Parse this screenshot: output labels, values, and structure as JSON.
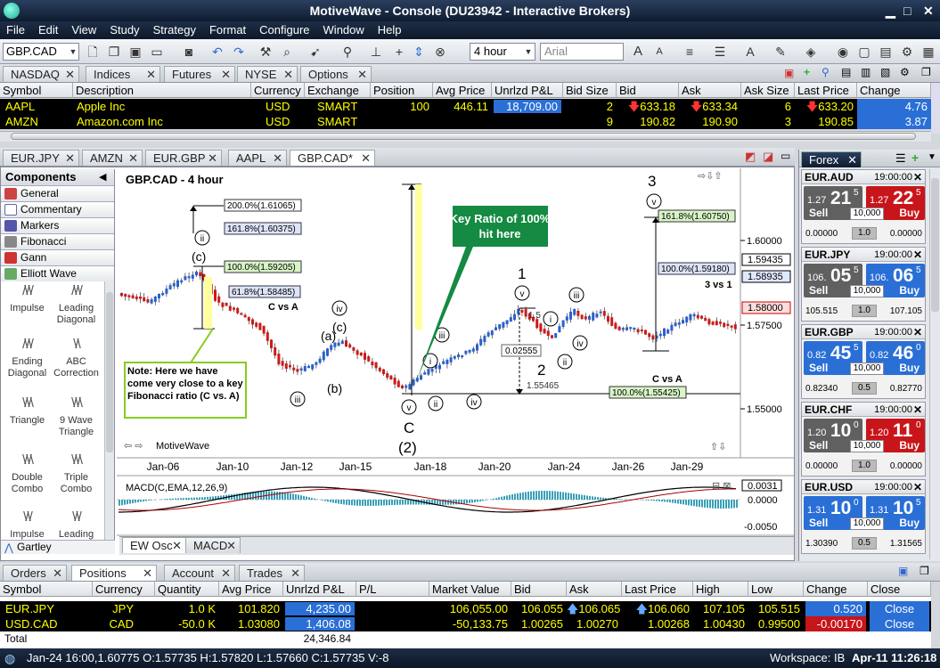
{
  "window": {
    "title": "MotiveWave - Console (DU23942 - Interactive Brokers)"
  },
  "menu": [
    "File",
    "Edit",
    "View",
    "Study",
    "Strategy",
    "Format",
    "Configure",
    "Window",
    "Help"
  ],
  "toolbar": {
    "symbol": "GBP.CAD",
    "bar_size": "4 hour",
    "font": "Arial"
  },
  "watch_tabs": [
    "NASDAQ",
    "Indices",
    "Futures",
    "NYSE",
    "Options"
  ],
  "watch_grid": {
    "headers": [
      "Symbol",
      "Description",
      "Currency",
      "Exchange",
      "Position",
      "Avg Price",
      "Unrlzd P&L",
      "Bid Size",
      "Bid",
      "Ask",
      "Ask Size",
      "Last Price",
      "Change"
    ],
    "rows": [
      [
        "AAPL",
        "Apple Inc",
        "USD",
        "SMART",
        "100",
        "446.11",
        "18,709.00",
        "2",
        "633.18",
        "633.34",
        "6",
        "633.20",
        "4.76"
      ],
      [
        "AMZN",
        "Amazon.com Inc",
        "USD",
        "SMART",
        "",
        "",
        "",
        "9",
        "190.82",
        "190.90",
        "3",
        "190.85",
        "3.87"
      ]
    ]
  },
  "chart_tabs": [
    "EUR.JPY",
    "AMZN",
    "EUR.GBP",
    "AAPL",
    "GBP.CAD*"
  ],
  "components": {
    "title": "Components",
    "items": [
      "General",
      "Commentary",
      "Markers",
      "Fibonacci",
      "Gann",
      "Elliott Wave"
    ],
    "tools": [
      [
        "Impulse",
        "Leading Diagonal"
      ],
      [
        "Ending Diagonal",
        "ABC Correction"
      ],
      [
        "Triangle",
        "9 Wave Triangle"
      ],
      [
        "Double Combo",
        "Triple Combo"
      ],
      [
        "Impulse",
        "Leading"
      ]
    ],
    "footer": "Gartley"
  },
  "chart": {
    "title": "GBP.CAD - 4 hour",
    "brand": "MotiveWave",
    "callout_key": "Key Ratio of 100% hit here",
    "note": "Note: Here we have come very close to a key Fibonacci ratio (C vs. A)",
    "labels": {
      "c_vs_a_1": "C vs A",
      "c_vs_a_2": "C vs A",
      "three_vs_one": "3 vs 1",
      "fib_200": "200.0%(1.61065)",
      "fib_1618a": "161.8%(1.60375)",
      "fib_100a": "100.0%(1.59205)",
      "fib_618": "61.8%(1.58485)",
      "fib_1618b": "161.8%(1.60750)",
      "fib_100b": "100.0%(1.59180)",
      "fib_100c": "100.0%(1.55425)",
      "measure": "0.02555",
      "low_price": "1.55465",
      "near_price": "1.5"
    },
    "waves": {
      "c_small": "(c)",
      "a_small": "(a)",
      "b_small": "(b)",
      "c2_small": "(c)",
      "C": "C",
      "two_paren": "(2)",
      "one": "1",
      "two": "2",
      "three": "3"
    },
    "roman": {
      "ii": "ii",
      "iii": "iii",
      "iv": "iv",
      "v": "v",
      "i": "i"
    },
    "price_axis": [
      "1.60000",
      "1.57500",
      "1.55000"
    ],
    "price_tags": {
      "t1": "1.59435",
      "t2": "1.58935",
      "t3": "1.58000"
    },
    "time_axis": [
      "Jan-06",
      "Jan-10",
      "Jan-12",
      "Jan-15",
      "Jan-18",
      "Jan-20",
      "Jan-24",
      "Jan-26",
      "Jan-29"
    ],
    "macd_title": "MACD(C,EMA,12,26,9)",
    "macd_axis": [
      "0.0031",
      "0.0000",
      "-0.0050"
    ],
    "bottom_tabs": [
      "EW Osc",
      "MACD"
    ]
  },
  "forex": {
    "tab": "Forex",
    "pairs": [
      {
        "name": "EUR.AUD",
        "time": "19:00:00",
        "sell_small": "1.27",
        "sell_big": "21",
        "sell_sup": "5",
        "buy_small": "1.27",
        "buy_big": "22",
        "buy_sup": "5",
        "qty": "10,000",
        "low": "0.00000",
        "spread": "1.0",
        "high": "0.00000",
        "sell_color": "#606060",
        "buy_color": "#c8151a"
      },
      {
        "name": "EUR.JPY",
        "time": "19:00:00",
        "sell_small": "106.",
        "sell_big": "05",
        "sell_sup": "5",
        "buy_small": "106.",
        "buy_big": "06",
        "buy_sup": "5",
        "qty": "10,000",
        "low": "105.515",
        "spread": "1.0",
        "high": "107.105",
        "sell_color": "#606060",
        "buy_color": "#2a6fd6"
      },
      {
        "name": "EUR.GBP",
        "time": "19:00:00",
        "sell_small": "0.82",
        "sell_big": "45",
        "sell_sup": "5",
        "buy_small": "0.82",
        "buy_big": "46",
        "buy_sup": "0",
        "qty": "10,000",
        "low": "0.82340",
        "spread": "0.5",
        "high": "0.82770",
        "sell_color": "#2a6fd6",
        "buy_color": "#2a6fd6"
      },
      {
        "name": "EUR.CHF",
        "time": "19:00:00",
        "sell_small": "1.20",
        "sell_big": "10",
        "sell_sup": "0",
        "buy_small": "1.20",
        "buy_big": "11",
        "buy_sup": "0",
        "qty": "10,000",
        "low": "0.00000",
        "spread": "1.0",
        "high": "0.00000",
        "sell_color": "#606060",
        "buy_color": "#c8151a"
      },
      {
        "name": "EUR.USD",
        "time": "19:00:00",
        "sell_small": "1.31",
        "sell_big": "10",
        "sell_sup": "0",
        "buy_small": "1.31",
        "buy_big": "10",
        "buy_sup": "5",
        "qty": "10,000",
        "low": "1.30390",
        "spread": "0.5",
        "high": "1.31565",
        "sell_color": "#2a6fd6",
        "buy_color": "#2a6fd6"
      }
    ],
    "sell_label": "Sell",
    "buy_label": "Buy"
  },
  "positions_tabs": [
    "Orders",
    "Positions",
    "Account",
    "Trades"
  ],
  "positions_grid": {
    "headers": [
      "Symbol",
      "Currency",
      "Quantity",
      "Avg Price",
      "Unrlzd P&L",
      "P/L",
      "Market Value",
      "Bid",
      "Ask",
      "Last Price",
      "High",
      "Low",
      "Change",
      "Close"
    ],
    "rows": [
      [
        "EUR.JPY",
        "JPY",
        "1.0 K",
        "101.820",
        "4,235.00",
        "",
        "106,055.00",
        "106.055",
        "106.065",
        "106.060",
        "107.105",
        "105.515",
        "0.520",
        "Close"
      ],
      [
        "USD.CAD",
        "CAD",
        "-50.0 K",
        "1.03080",
        "1,406.08",
        "",
        "-50,133.75",
        "1.00265",
        "1.00270",
        "1.00268",
        "1.00430",
        "0.99500",
        "-0.00170",
        "Close"
      ]
    ],
    "total_label": "Total",
    "total_value": "24,346.84"
  },
  "status": {
    "bar_info": "Jan-24 16:00,1.60775 O:1.57735 H:1.57820 L:1.57660 C:1.57735 V:-8",
    "workspace": "Workspace: IB",
    "datetime": "Apr-11 11:26:18"
  }
}
